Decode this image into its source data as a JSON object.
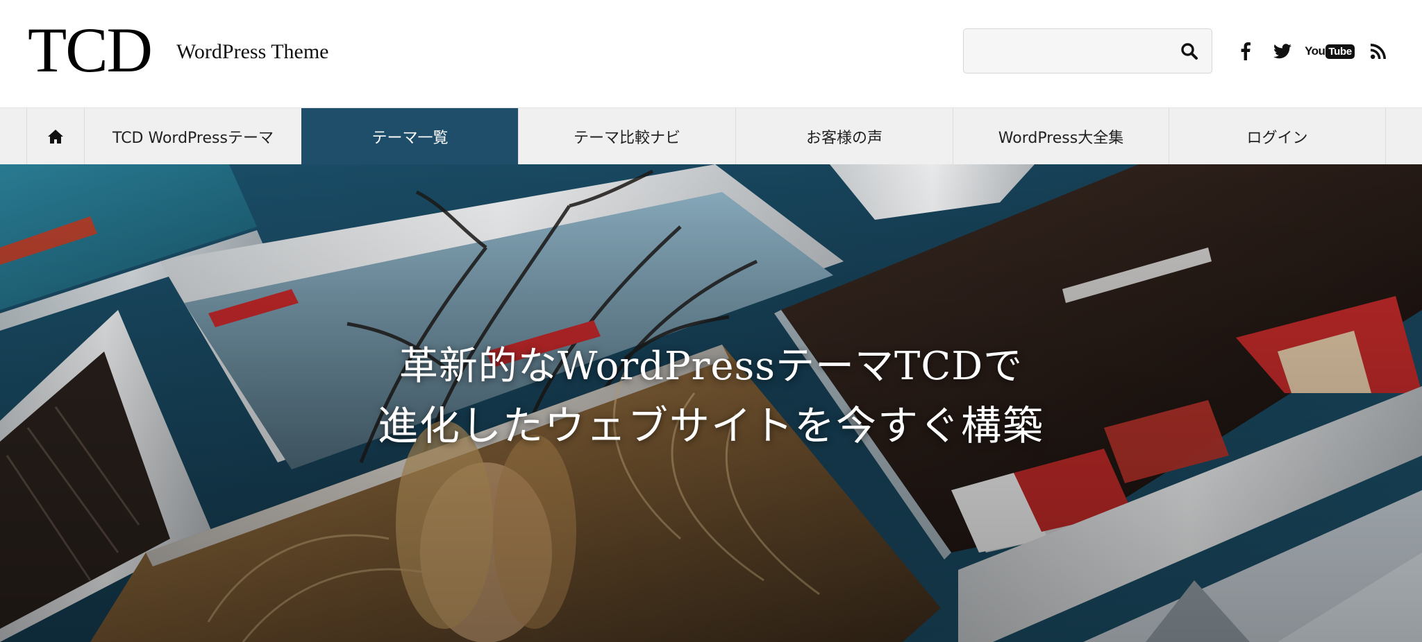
{
  "header": {
    "logo": "TCD",
    "tagline": "WordPress Theme",
    "search": {
      "value": "",
      "placeholder": ""
    },
    "social": [
      "facebook-icon",
      "twitter-icon",
      "youtube-icon",
      "rss-icon"
    ],
    "youtube_you": "You",
    "youtube_tube": "Tube"
  },
  "nav": {
    "items": [
      {
        "label": "TCD WordPressテーマ"
      },
      {
        "label": "テーマ一覧",
        "active": true
      },
      {
        "label": "テーマ比較ナビ"
      },
      {
        "label": "お客様の声"
      },
      {
        "label": "WordPress大全集"
      },
      {
        "label": "ログイン"
      }
    ]
  },
  "hero": {
    "line1": "革新的なWordPressテーマTCDで",
    "line2": "進化したウェブサイトを今すぐ構築"
  },
  "colors": {
    "nav_active": "#1e4e6a",
    "nav_bg": "#f0f0f0",
    "hero_bg": "#1b4d66"
  }
}
